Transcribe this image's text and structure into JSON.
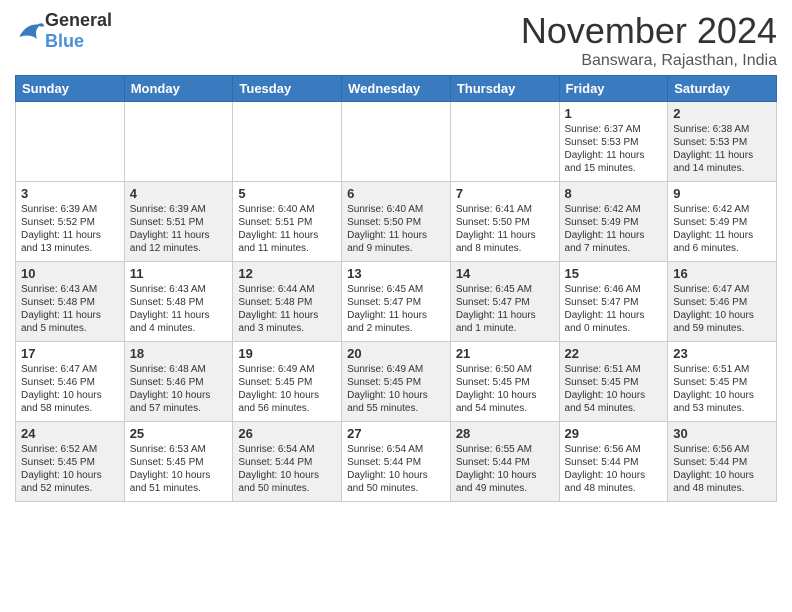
{
  "logo": {
    "general": "General",
    "blue": "Blue"
  },
  "title": {
    "month_year": "November 2024",
    "location": "Banswara, Rajasthan, India"
  },
  "headers": [
    "Sunday",
    "Monday",
    "Tuesday",
    "Wednesday",
    "Thursday",
    "Friday",
    "Saturday"
  ],
  "weeks": [
    [
      {
        "day": "",
        "info": "",
        "shaded": false
      },
      {
        "day": "",
        "info": "",
        "shaded": false
      },
      {
        "day": "",
        "info": "",
        "shaded": false
      },
      {
        "day": "",
        "info": "",
        "shaded": false
      },
      {
        "day": "",
        "info": "",
        "shaded": false
      },
      {
        "day": "1",
        "info": "Sunrise: 6:37 AM\nSunset: 5:53 PM\nDaylight: 11 hours and 15 minutes.",
        "shaded": false
      },
      {
        "day": "2",
        "info": "Sunrise: 6:38 AM\nSunset: 5:53 PM\nDaylight: 11 hours and 14 minutes.",
        "shaded": true
      }
    ],
    [
      {
        "day": "3",
        "info": "Sunrise: 6:39 AM\nSunset: 5:52 PM\nDaylight: 11 hours and 13 minutes.",
        "shaded": false
      },
      {
        "day": "4",
        "info": "Sunrise: 6:39 AM\nSunset: 5:51 PM\nDaylight: 11 hours and 12 minutes.",
        "shaded": true
      },
      {
        "day": "5",
        "info": "Sunrise: 6:40 AM\nSunset: 5:51 PM\nDaylight: 11 hours and 11 minutes.",
        "shaded": false
      },
      {
        "day": "6",
        "info": "Sunrise: 6:40 AM\nSunset: 5:50 PM\nDaylight: 11 hours and 9 minutes.",
        "shaded": true
      },
      {
        "day": "7",
        "info": "Sunrise: 6:41 AM\nSunset: 5:50 PM\nDaylight: 11 hours and 8 minutes.",
        "shaded": false
      },
      {
        "day": "8",
        "info": "Sunrise: 6:42 AM\nSunset: 5:49 PM\nDaylight: 11 hours and 7 minutes.",
        "shaded": true
      },
      {
        "day": "9",
        "info": "Sunrise: 6:42 AM\nSunset: 5:49 PM\nDaylight: 11 hours and 6 minutes.",
        "shaded": false
      }
    ],
    [
      {
        "day": "10",
        "info": "Sunrise: 6:43 AM\nSunset: 5:48 PM\nDaylight: 11 hours and 5 minutes.",
        "shaded": true
      },
      {
        "day": "11",
        "info": "Sunrise: 6:43 AM\nSunset: 5:48 PM\nDaylight: 11 hours and 4 minutes.",
        "shaded": false
      },
      {
        "day": "12",
        "info": "Sunrise: 6:44 AM\nSunset: 5:48 PM\nDaylight: 11 hours and 3 minutes.",
        "shaded": true
      },
      {
        "day": "13",
        "info": "Sunrise: 6:45 AM\nSunset: 5:47 PM\nDaylight: 11 hours and 2 minutes.",
        "shaded": false
      },
      {
        "day": "14",
        "info": "Sunrise: 6:45 AM\nSunset: 5:47 PM\nDaylight: 11 hours and 1 minute.",
        "shaded": true
      },
      {
        "day": "15",
        "info": "Sunrise: 6:46 AM\nSunset: 5:47 PM\nDaylight: 11 hours and 0 minutes.",
        "shaded": false
      },
      {
        "day": "16",
        "info": "Sunrise: 6:47 AM\nSunset: 5:46 PM\nDaylight: 10 hours and 59 minutes.",
        "shaded": true
      }
    ],
    [
      {
        "day": "17",
        "info": "Sunrise: 6:47 AM\nSunset: 5:46 PM\nDaylight: 10 hours and 58 minutes.",
        "shaded": false
      },
      {
        "day": "18",
        "info": "Sunrise: 6:48 AM\nSunset: 5:46 PM\nDaylight: 10 hours and 57 minutes.",
        "shaded": true
      },
      {
        "day": "19",
        "info": "Sunrise: 6:49 AM\nSunset: 5:45 PM\nDaylight: 10 hours and 56 minutes.",
        "shaded": false
      },
      {
        "day": "20",
        "info": "Sunrise: 6:49 AM\nSunset: 5:45 PM\nDaylight: 10 hours and 55 minutes.",
        "shaded": true
      },
      {
        "day": "21",
        "info": "Sunrise: 6:50 AM\nSunset: 5:45 PM\nDaylight: 10 hours and 54 minutes.",
        "shaded": false
      },
      {
        "day": "22",
        "info": "Sunrise: 6:51 AM\nSunset: 5:45 PM\nDaylight: 10 hours and 54 minutes.",
        "shaded": true
      },
      {
        "day": "23",
        "info": "Sunrise: 6:51 AM\nSunset: 5:45 PM\nDaylight: 10 hours and 53 minutes.",
        "shaded": false
      }
    ],
    [
      {
        "day": "24",
        "info": "Sunrise: 6:52 AM\nSunset: 5:45 PM\nDaylight: 10 hours and 52 minutes.",
        "shaded": true
      },
      {
        "day": "25",
        "info": "Sunrise: 6:53 AM\nSunset: 5:45 PM\nDaylight: 10 hours and 51 minutes.",
        "shaded": false
      },
      {
        "day": "26",
        "info": "Sunrise: 6:54 AM\nSunset: 5:44 PM\nDaylight: 10 hours and 50 minutes.",
        "shaded": true
      },
      {
        "day": "27",
        "info": "Sunrise: 6:54 AM\nSunset: 5:44 PM\nDaylight: 10 hours and 50 minutes.",
        "shaded": false
      },
      {
        "day": "28",
        "info": "Sunrise: 6:55 AM\nSunset: 5:44 PM\nDaylight: 10 hours and 49 minutes.",
        "shaded": true
      },
      {
        "day": "29",
        "info": "Sunrise: 6:56 AM\nSunset: 5:44 PM\nDaylight: 10 hours and 48 minutes.",
        "shaded": false
      },
      {
        "day": "30",
        "info": "Sunrise: 6:56 AM\nSunset: 5:44 PM\nDaylight: 10 hours and 48 minutes.",
        "shaded": true
      }
    ]
  ]
}
